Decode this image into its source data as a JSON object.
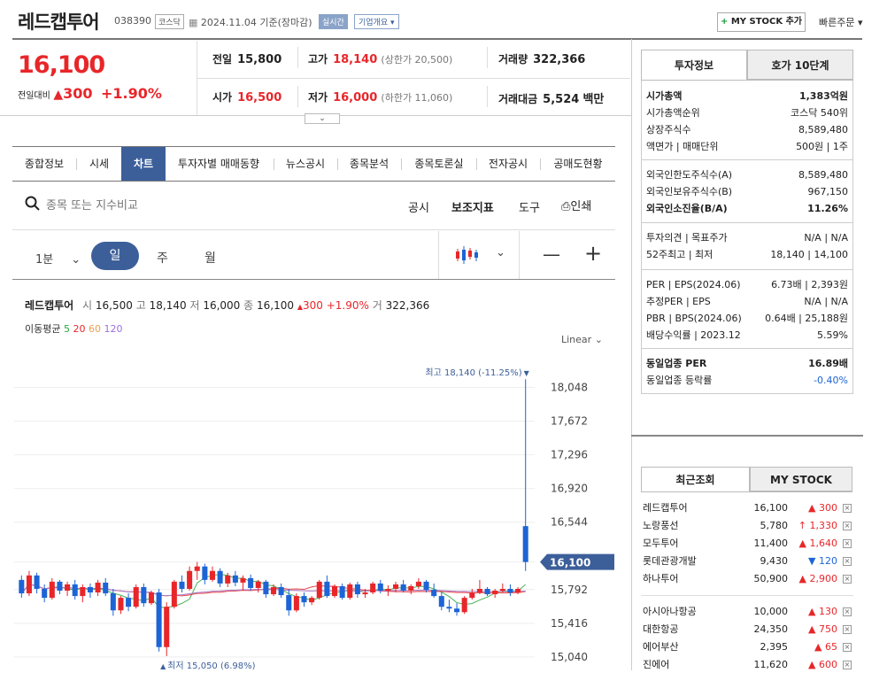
{
  "header": {
    "stock_name": "레드캡투어",
    "code": "038390",
    "market": "코스닥",
    "date_text": "2024.11.04 기준(장마감)",
    "live_badge": "실시간",
    "overview_btn": "기업개요",
    "mystock_btn": "MY STOCK 추가",
    "quick_order": "빠른주문"
  },
  "price": {
    "current": "16,100",
    "change_label": "전일대비",
    "change_abs": "300",
    "change_pct": "+1.90%"
  },
  "quote": {
    "prev_label": "전일",
    "prev": "15,800",
    "high_label": "고가",
    "high": "18,140",
    "upper_limit": "(상한가 20,500)",
    "volume_label": "거래량",
    "volume": "322,366",
    "open_label": "시가",
    "open": "16,500",
    "low_label": "저가",
    "low": "16,000",
    "lower_limit": "(하한가 11,060)",
    "amount_label": "거래대금",
    "amount": "5,524",
    "amount_unit": "백만"
  },
  "tabs": [
    "종합정보",
    "시세",
    "차트",
    "투자자별 매매동향",
    "뉴스공시",
    "종목분석",
    "종목토론실",
    "전자공시",
    "공매도현황"
  ],
  "search": {
    "placeholder": "종목 또는 지수비교",
    "tools": [
      "공시",
      "보조지표",
      "도구",
      "인쇄"
    ]
  },
  "period": {
    "minute": "1분",
    "day": "일",
    "week": "주",
    "month": "월"
  },
  "chart_info": {
    "name": "레드캡투어",
    "open_label": "시",
    "open": "16,500",
    "high_label": "고",
    "high": "18,140",
    "low_label": "저",
    "low": "16,000",
    "close_label": "종",
    "close": "16,100",
    "chg": "300 +1.90%",
    "vol_label": "거",
    "vol": "322,366",
    "ma_label": "이동평균",
    "ma": [
      "5",
      "20",
      "60",
      "120"
    ],
    "ma_colors": [
      "#2aa43a",
      "#e8262a",
      "#f0a050",
      "#9a6fe0"
    ],
    "scale": "Linear",
    "max_label": "최고 18,140 (-11.25%)",
    "min_label": "최저 15,050 (6.98%)",
    "current_tag": "16,100"
  },
  "chart_data": {
    "type": "candlestick",
    "y_ticks": [
      18048,
      17672,
      17296,
      16920,
      16544,
      16100,
      15792,
      15416,
      15040
    ],
    "ylim": [
      14940,
      18340
    ],
    "colors": {
      "up": "#e8262a",
      "down": "#1d64d6"
    },
    "candles": [
      {
        "o": 15900,
        "h": 15950,
        "l": 15700,
        "c": 15750
      },
      {
        "o": 15750,
        "h": 16000,
        "l": 15720,
        "c": 15950
      },
      {
        "o": 15950,
        "h": 15980,
        "l": 15750,
        "c": 15800
      },
      {
        "o": 15800,
        "h": 15850,
        "l": 15650,
        "c": 15700
      },
      {
        "o": 15700,
        "h": 15920,
        "l": 15680,
        "c": 15880
      },
      {
        "o": 15880,
        "h": 15900,
        "l": 15740,
        "c": 15780
      },
      {
        "o": 15780,
        "h": 15880,
        "l": 15720,
        "c": 15850
      },
      {
        "o": 15850,
        "h": 15900,
        "l": 15680,
        "c": 15720
      },
      {
        "o": 15720,
        "h": 15850,
        "l": 15650,
        "c": 15820
      },
      {
        "o": 15820,
        "h": 15860,
        "l": 15700,
        "c": 15760
      },
      {
        "o": 15760,
        "h": 15900,
        "l": 15720,
        "c": 15870
      },
      {
        "o": 15870,
        "h": 15920,
        "l": 15720,
        "c": 15750
      },
      {
        "o": 15750,
        "h": 15800,
        "l": 15500,
        "c": 15560
      },
      {
        "o": 15560,
        "h": 15720,
        "l": 15520,
        "c": 15700
      },
      {
        "o": 15700,
        "h": 15750,
        "l": 15550,
        "c": 15600
      },
      {
        "o": 15600,
        "h": 15850,
        "l": 15580,
        "c": 15820
      },
      {
        "o": 15820,
        "h": 15860,
        "l": 15600,
        "c": 15640
      },
      {
        "o": 15640,
        "h": 15780,
        "l": 15620,
        "c": 15760
      },
      {
        "o": 15760,
        "h": 15800,
        "l": 15100,
        "c": 15150
      },
      {
        "o": 15150,
        "h": 15650,
        "l": 15050,
        "c": 15600
      },
      {
        "o": 15600,
        "h": 15900,
        "l": 15580,
        "c": 15880
      },
      {
        "o": 15880,
        "h": 15950,
        "l": 15760,
        "c": 15800
      },
      {
        "o": 15800,
        "h": 16050,
        "l": 15780,
        "c": 16000
      },
      {
        "o": 16000,
        "h": 16100,
        "l": 15900,
        "c": 16050
      },
      {
        "o": 16050,
        "h": 16080,
        "l": 15850,
        "c": 15900
      },
      {
        "o": 15900,
        "h": 16050,
        "l": 15880,
        "c": 16000
      },
      {
        "o": 16000,
        "h": 16030,
        "l": 15820,
        "c": 15860
      },
      {
        "o": 15860,
        "h": 15980,
        "l": 15820,
        "c": 15950
      },
      {
        "o": 15950,
        "h": 16000,
        "l": 15830,
        "c": 15870
      },
      {
        "o": 15870,
        "h": 15950,
        "l": 15780,
        "c": 15920
      },
      {
        "o": 15920,
        "h": 15960,
        "l": 15780,
        "c": 15810
      },
      {
        "o": 15810,
        "h": 15900,
        "l": 15760,
        "c": 15880
      },
      {
        "o": 15880,
        "h": 15900,
        "l": 15700,
        "c": 15740
      },
      {
        "o": 15740,
        "h": 15850,
        "l": 15720,
        "c": 15820
      },
      {
        "o": 15820,
        "h": 15860,
        "l": 15700,
        "c": 15730
      },
      {
        "o": 15730,
        "h": 15800,
        "l": 15500,
        "c": 15560
      },
      {
        "o": 15560,
        "h": 15750,
        "l": 15540,
        "c": 15720
      },
      {
        "o": 15720,
        "h": 15760,
        "l": 15600,
        "c": 15650
      },
      {
        "o": 15650,
        "h": 15720,
        "l": 15620,
        "c": 15700
      },
      {
        "o": 15700,
        "h": 15900,
        "l": 15680,
        "c": 15880
      },
      {
        "o": 15880,
        "h": 15950,
        "l": 15700,
        "c": 15720
      },
      {
        "o": 15720,
        "h": 15850,
        "l": 15700,
        "c": 15830
      },
      {
        "o": 15830,
        "h": 15860,
        "l": 15680,
        "c": 15700
      },
      {
        "o": 15700,
        "h": 15870,
        "l": 15680,
        "c": 15850
      },
      {
        "o": 15850,
        "h": 15880,
        "l": 15700,
        "c": 15740
      },
      {
        "o": 15740,
        "h": 15800,
        "l": 15700,
        "c": 15760
      },
      {
        "o": 15760,
        "h": 15880,
        "l": 15740,
        "c": 15860
      },
      {
        "o": 15860,
        "h": 15900,
        "l": 15750,
        "c": 15780
      },
      {
        "o": 15780,
        "h": 15840,
        "l": 15720,
        "c": 15800
      },
      {
        "o": 15800,
        "h": 15880,
        "l": 15760,
        "c": 15850
      },
      {
        "o": 15850,
        "h": 15900,
        "l": 15760,
        "c": 15780
      },
      {
        "o": 15780,
        "h": 15850,
        "l": 15740,
        "c": 15830
      },
      {
        "o": 15830,
        "h": 15920,
        "l": 15800,
        "c": 15880
      },
      {
        "o": 15880,
        "h": 15900,
        "l": 15760,
        "c": 15790
      },
      {
        "o": 15790,
        "h": 15860,
        "l": 15700,
        "c": 15720
      },
      {
        "o": 15720,
        "h": 15760,
        "l": 15560,
        "c": 15600
      },
      {
        "o": 15600,
        "h": 15680,
        "l": 15540,
        "c": 15580
      },
      {
        "o": 15580,
        "h": 15640,
        "l": 15500,
        "c": 15540
      },
      {
        "o": 15540,
        "h": 15720,
        "l": 15520,
        "c": 15700
      },
      {
        "o": 15700,
        "h": 15800,
        "l": 15680,
        "c": 15760
      },
      {
        "o": 15760,
        "h": 15900,
        "l": 15740,
        "c": 15800
      },
      {
        "o": 15800,
        "h": 15820,
        "l": 15720,
        "c": 15740
      },
      {
        "o": 15740,
        "h": 15800,
        "l": 15700,
        "c": 15780
      },
      {
        "o": 15780,
        "h": 15860,
        "l": 15760,
        "c": 15800
      },
      {
        "o": 15800,
        "h": 15850,
        "l": 15720,
        "c": 15760
      },
      {
        "o": 15760,
        "h": 15820,
        "l": 15740,
        "c": 15800
      },
      {
        "o": 16500,
        "h": 18140,
        "l": 16000,
        "c": 16100
      }
    ]
  },
  "right": {
    "tab_invest": "투자정보",
    "tab_order": "호가 10단계",
    "rows1": [
      {
        "label": "시가총액",
        "value": "1,383억원",
        "bold": true
      },
      {
        "label": "시가총액순위",
        "value": "코스닥 540위"
      },
      {
        "label": "상장주식수",
        "value": "8,589,480"
      },
      {
        "label": "액면가 | 매매단위",
        "value": "500원 | 1주"
      }
    ],
    "rows2": [
      {
        "label": "외국인한도주식수(A)",
        "value": "8,589,480"
      },
      {
        "label": "외국인보유주식수(B)",
        "value": "967,150"
      },
      {
        "label": "외국인소진율(B/A)",
        "value": "11.26%",
        "bold": true
      }
    ],
    "rows3": [
      {
        "label": "투자의견 | 목표주가",
        "value": "N/A | N/A"
      },
      {
        "label": "52주최고 | 최저",
        "value": "18,140 | 14,100"
      }
    ],
    "rows4": [
      {
        "label": "PER | EPS(2024.06)",
        "value": "6.73배 | 2,393원"
      },
      {
        "label": "추정PER | EPS",
        "value": "N/A | N/A"
      },
      {
        "label": "PBR | BPS(2024.06)",
        "value": "0.64배 | 25,188원"
      },
      {
        "label": "배당수익률 | 2023.12",
        "value": "5.59%"
      }
    ],
    "rows5": [
      {
        "label": "동일업종 PER",
        "value": "16.89배",
        "bold": true
      },
      {
        "label": "동일업종 등락률",
        "value": "-0.40%",
        "blue": true
      }
    ],
    "recent_tab": "최근조회",
    "mystock_tab": "MY STOCK",
    "recent1": [
      {
        "name": "레드캡투어",
        "price": "16,100",
        "chg": "300",
        "dir": "up"
      },
      {
        "name": "노랑풍선",
        "price": "5,780",
        "chg": "1,330",
        "dir": "upper"
      },
      {
        "name": "모두투어",
        "price": "11,400",
        "chg": "1,640",
        "dir": "up"
      },
      {
        "name": "롯데관광개발",
        "price": "9,430",
        "chg": "120",
        "dir": "down"
      },
      {
        "name": "하나투어",
        "price": "50,900",
        "chg": "2,900",
        "dir": "up"
      }
    ],
    "recent2": [
      {
        "name": "아시아나항공",
        "price": "10,000",
        "chg": "130",
        "dir": "up"
      },
      {
        "name": "대한항공",
        "price": "24,350",
        "chg": "750",
        "dir": "up"
      },
      {
        "name": "에어부산",
        "price": "2,395",
        "chg": "65",
        "dir": "up"
      },
      {
        "name": "진에어",
        "price": "11,620",
        "chg": "600",
        "dir": "up"
      }
    ]
  }
}
